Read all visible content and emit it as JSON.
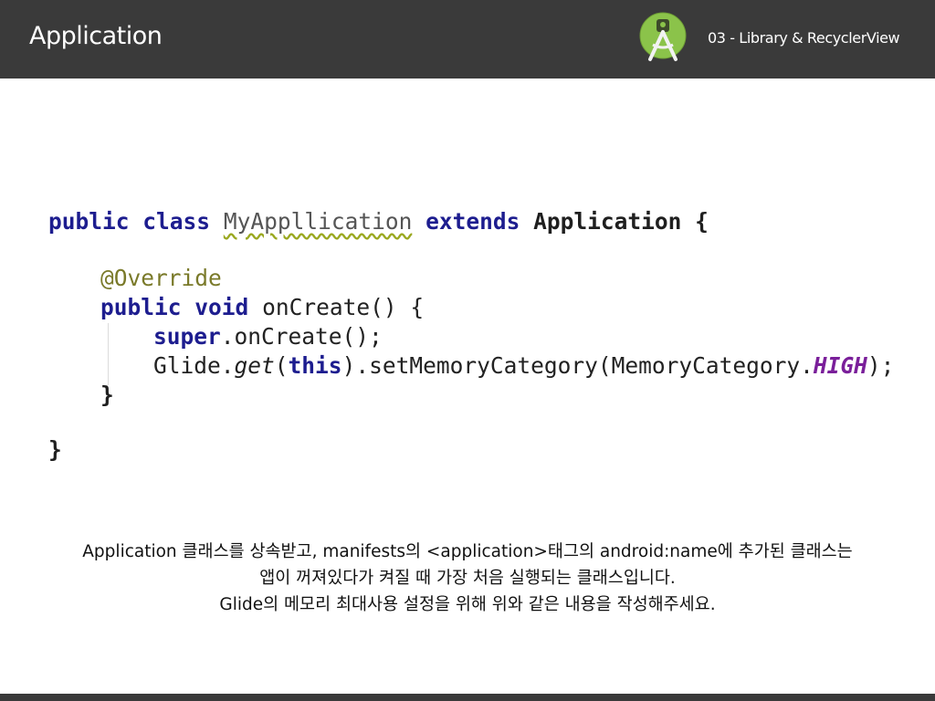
{
  "header": {
    "title": "Application",
    "subtitle": "03 - Library & RecyclerView",
    "logo_icon": "android-studio-icon",
    "background": "#3a3a3a"
  },
  "code": {
    "line1": {
      "public": "public",
      "class": "class",
      "name": "MyAppllication",
      "extends": "extends",
      "parent": "Application",
      "brace": "{"
    },
    "line2": {
      "annotation": "@Override"
    },
    "line3": {
      "public": "public",
      "void": "void",
      "rest": "onCreate() {"
    },
    "line4": {
      "super": "super",
      "rest": ".onCreate();"
    },
    "line5": {
      "glide": "Glide.",
      "get": "get",
      "paren_open": "(",
      "this": "this",
      "mid": ").setMemoryCategory(MemoryCategory.",
      "high": "HIGH",
      "end": ");"
    },
    "line6": {
      "text": "}"
    },
    "line7": {
      "text": "}"
    }
  },
  "caption": {
    "line1": "Application 클래스를 상속받고, manifests의 <application>태그의 android:name에 추가된 클래스는",
    "line2": "앱이 꺼져있다가 켜질 때 가장 처음 실행되는 클래스입니다.",
    "line3": "Glide의 메모리 최대사용 설정을 위해 위와 같은 내용을 작성해주세요."
  }
}
